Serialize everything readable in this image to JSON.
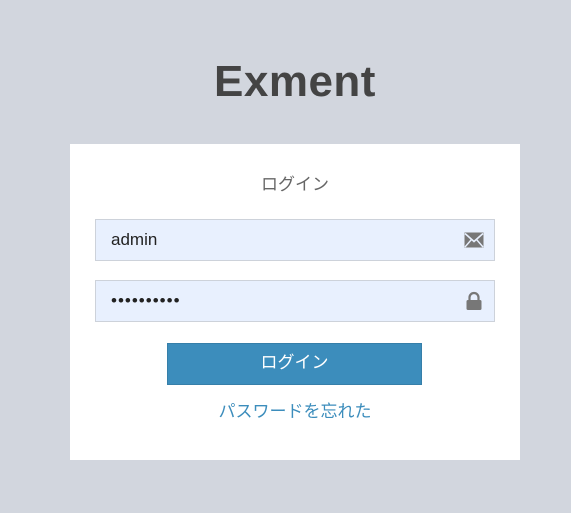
{
  "app": {
    "logo_text": "Exment"
  },
  "login": {
    "title": "ログイン",
    "username_value": "admin",
    "password_value": "••••••••••",
    "username_icon": "envelope-icon",
    "password_icon": "lock-icon",
    "submit_label": "ログイン",
    "forgot_label": "パスワードを忘れた"
  },
  "colors": {
    "background": "#d2d6de",
    "logo": "#444444",
    "input_bg": "#e8f0fe",
    "button": "#3c8dbc",
    "link": "#3c8dbc"
  }
}
